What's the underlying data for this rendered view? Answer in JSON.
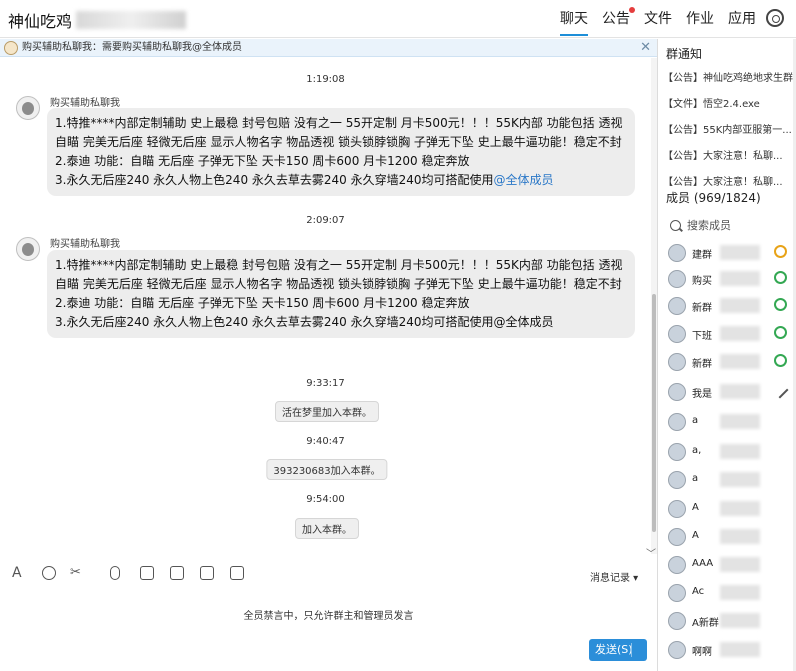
{
  "window": {
    "title": "神仙吃鸡"
  },
  "nav": {
    "tabs": [
      {
        "label": "聊天"
      },
      {
        "label": "公告"
      },
      {
        "label": "文件"
      },
      {
        "label": "作业"
      },
      {
        "label": "应用"
      }
    ],
    "accent": "#1d8ed8",
    "unread_dot_color": "#e53d3d"
  },
  "pinned_notice": {
    "text": "购买辅助私聊我：需要购买辅助私聊我@全体成员"
  },
  "chat": {
    "messages": [
      {
        "time": "1:19:08",
        "sender": "购买辅助私聊我",
        "lines": [
          "1.特推****内部定制辅助 史上最稳  封号包赔 没有之一  55开定制 月卡500元！！！55K内部 功能包括 透视 自瞄 完美无后座 轻微无后座 显示人物名字 物品透视 锁头锁脖锁胸 子弹无下坠 史上最牛逼功能！稳定不封",
          "2.泰迪  功能：自瞄 无后座 子弹无下坠 天卡150 周卡600 月卡1200 稳定奔放",
          "3.永久无后座240 永久人物上色240 永久去草去雾240 永久穿墙240均可搭配使用"
        ],
        "mention": "@全体成员"
      },
      {
        "time": "2:09:07",
        "sender": "购买辅助私聊我",
        "lines": [
          "1.特推****内部定制辅助 史上最稳  封号包赔 没有之一  55开定制 月卡500元！！！55K内部 功能包括 透视 自瞄 完美无后座 轻微无后座 显示人物名字 物品透视 锁头锁脖锁胸 子弹无下坠 史上最牛逼功能！稳定不封",
          "2.泰迪  功能：自瞄 无后座 子弹无下坠 天卡150 周卡600 月卡1200 稳定奔放",
          "3.永久无后座240 永久人物上色240 永久去草去雾240 永久穿墙240均可搭配使用@全体成员"
        ]
      }
    ],
    "system_events": [
      {
        "time": "9:33:17",
        "text": "活在梦里加入本群。"
      },
      {
        "time": "9:40:47",
        "text": "393230683加入本群。"
      },
      {
        "time": "9:54:00",
        "text": "加入本群。"
      }
    ]
  },
  "toolbar": {
    "icons": [
      "font-icon",
      "emoji-icon",
      "scissors-icon",
      "voice-icon",
      "sticker-icon",
      "image-icon",
      "folder-icon",
      "clipboard-icon"
    ],
    "history_label": "消息记录"
  },
  "composer": {
    "muted_notice": "全员禁言中，只允许群主和管理员发言",
    "send_label": "发送(S)"
  },
  "sidebar": {
    "notice_title": "群通知",
    "notices": [
      "【公告】神仙吃鸡绝地求生群号...",
      "【文件】悟空2.4.exe",
      "【公告】55K内部亚服第一...",
      "【公告】大家注意！私聊...",
      "【公告】大家注意！私聊..."
    ],
    "members_title": "成员 (969/1824)",
    "search_placeholder": "搜索成员",
    "members": [
      {
        "name": "建群",
        "badge": "owner"
      },
      {
        "name": "购买",
        "badge": "admin"
      },
      {
        "name": "新群",
        "badge": "admin"
      },
      {
        "name": "下班",
        "badge": "admin"
      },
      {
        "name": "新群",
        "badge": "admin"
      },
      {
        "name": "我是",
        "badge": "edit"
      },
      {
        "name": "a",
        "badge": "none"
      },
      {
        "name": "a,",
        "badge": "none"
      },
      {
        "name": "a",
        "badge": "none"
      },
      {
        "name": "A",
        "badge": "none"
      },
      {
        "name": "A",
        "badge": "none"
      },
      {
        "name": "AAA",
        "badge": "none"
      },
      {
        "name": "Ac",
        "badge": "none"
      },
      {
        "name": "A新群",
        "badge": "none"
      },
      {
        "name": "啊啊",
        "badge": "none"
      }
    ]
  }
}
